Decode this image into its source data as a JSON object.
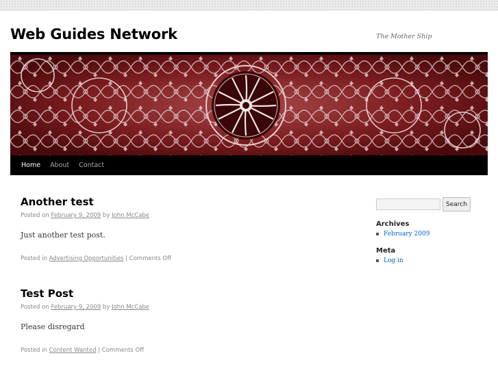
{
  "site": {
    "title": "Web Guides Network",
    "description": "The Mother Ship"
  },
  "nav": {
    "items": [
      {
        "label": "Home"
      },
      {
        "label": "About"
      },
      {
        "label": "Contact"
      }
    ]
  },
  "posts": [
    {
      "title": "Another test",
      "posted_on": "Posted on",
      "date": "February 9, 2009",
      "by": "by",
      "author": "John McCabe",
      "content": "Just another test post.",
      "posted_in": "Posted in",
      "category": "Advertising Opportunities",
      "separator": " | ",
      "comments": "Comments Off"
    },
    {
      "title": "Test Post",
      "posted_on": "Posted on",
      "date": "February 9, 2009",
      "by": "by",
      "author": "John McCabe",
      "content": "Please disregard",
      "posted_in": "Posted in",
      "category": "Content Wanted",
      "separator": " | ",
      "comments": "Comments Off"
    }
  ],
  "sidebar": {
    "search": {
      "placeholder": "",
      "button_label": "Search"
    },
    "archives": {
      "title": "Archives",
      "items": [
        "February 2009"
      ]
    },
    "meta": {
      "title": "Meta",
      "items": [
        "Log in"
      ]
    }
  },
  "colors": {
    "link": "#0066cc",
    "nav_background": "#000000",
    "header_image_base": "#5a0f10"
  }
}
